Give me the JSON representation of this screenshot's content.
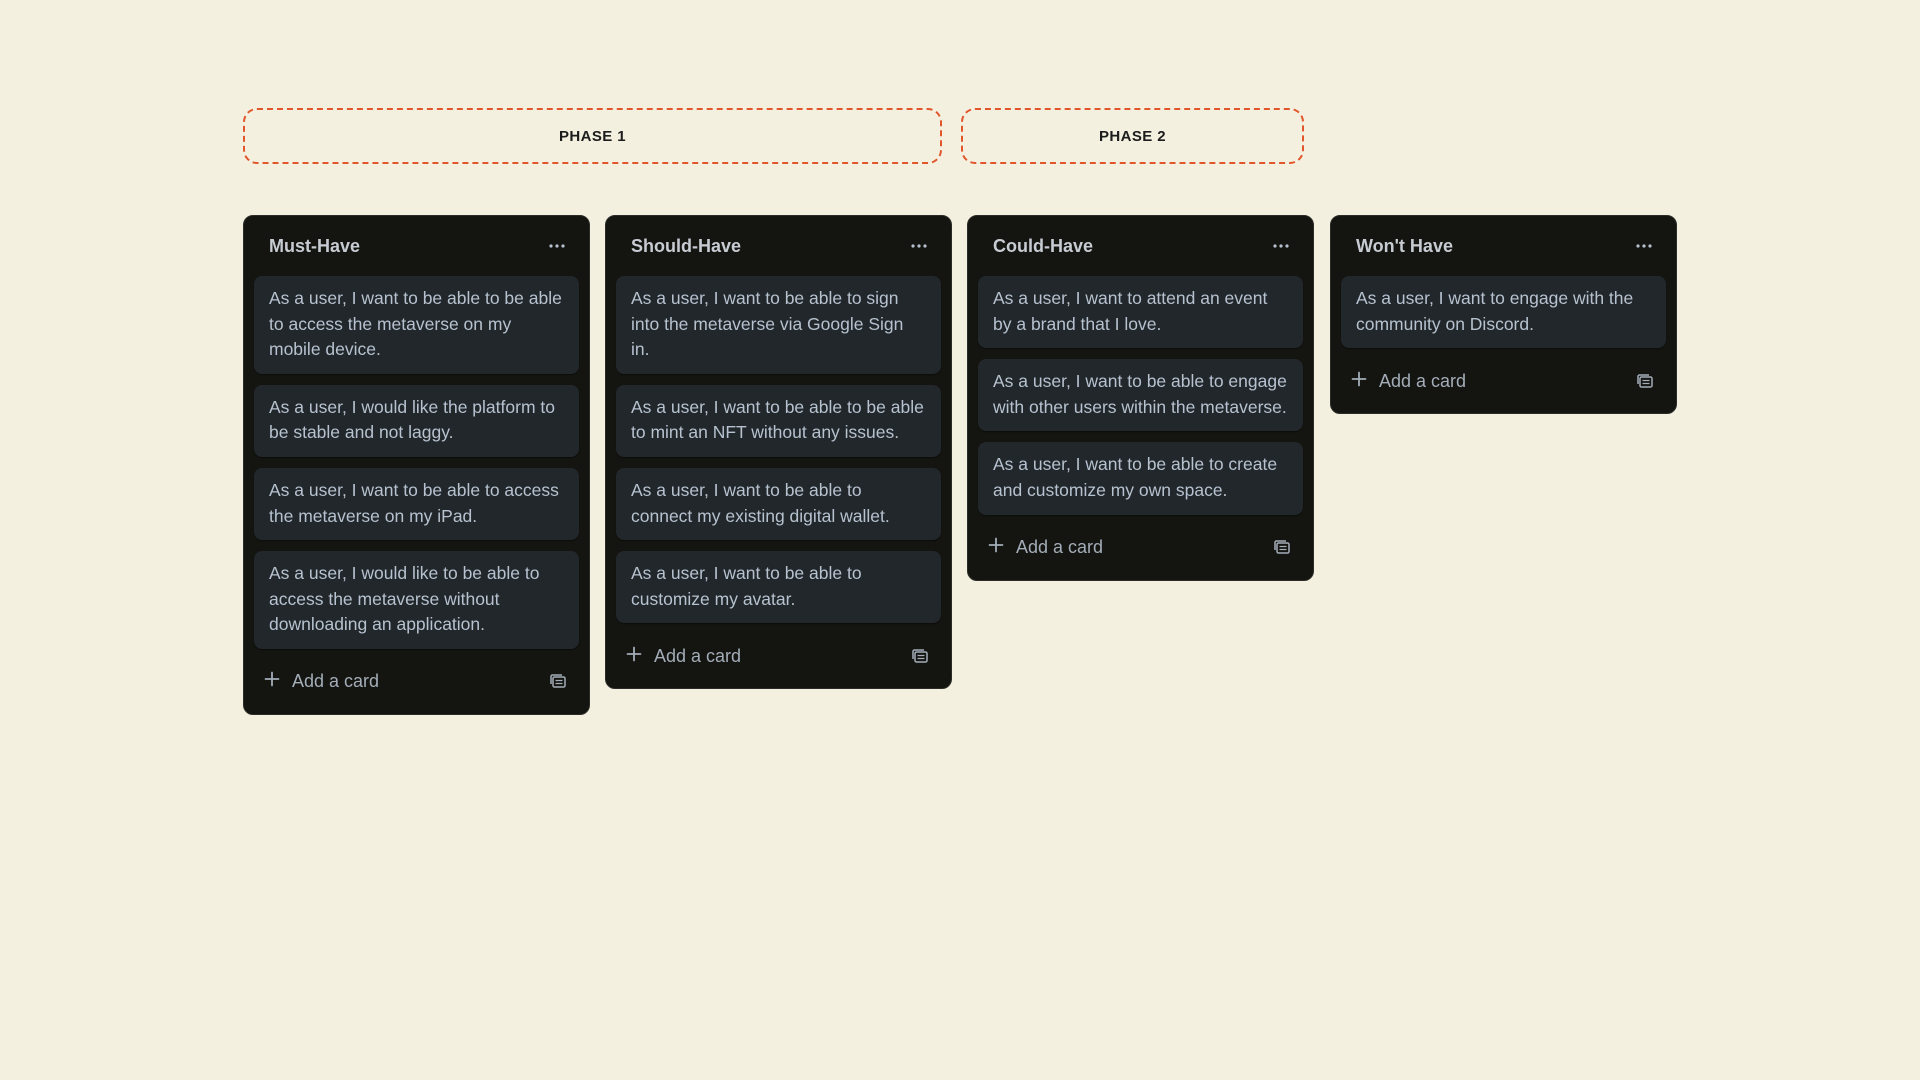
{
  "phases": [
    {
      "label": "PHASE 1"
    },
    {
      "label": "PHASE 2"
    }
  ],
  "lists": [
    {
      "title": "Must-Have",
      "cards": [
        "As a user, I want to be able to be able to access the metaverse on my mobile device.",
        "As a user, I would like the platform to be stable and not laggy.",
        "As a user, I want to be able to access the metaverse on my iPad.",
        "As a user, I would like to be able to access the metaverse without downloading an application."
      ],
      "add_label": "Add a card"
    },
    {
      "title": "Should-Have",
      "cards": [
        "As a user, I want to be able to sign into the metaverse via Google Sign in.",
        "As a user, I want to be able to be able to mint an NFT without any issues.",
        "As a user, I want to be able to connect my existing digital wallet.",
        "As a user, I want to be able to customize my avatar."
      ],
      "add_label": "Add a card"
    },
    {
      "title": "Could-Have",
      "cards": [
        "As a user, I want to attend an event by a brand that I love.",
        "As a user, I want to be able to engage with other users within the metaverse.",
        "As a user, I want to be able to create and customize my own space."
      ],
      "add_label": "Add a card"
    },
    {
      "title": "Won't Have",
      "cards": [
        "As a user, I want to engage with the community on Discord."
      ],
      "add_label": "Add a card"
    }
  ],
  "icons": {
    "menu": "more-horizontal-icon",
    "add": "plus-icon",
    "template": "card-template-icon"
  },
  "colors": {
    "background": "#f4f0e0",
    "phase_border": "#e2562c",
    "list_bg": "#141410",
    "card_bg": "#22272b",
    "card_text": "#b6c2cf"
  }
}
